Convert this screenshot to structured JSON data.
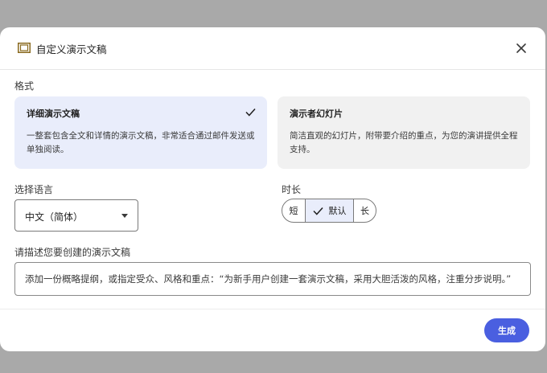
{
  "dialog": {
    "title": "自定义演示文稿",
    "title_icon": "slides-icon",
    "close_icon": "close-icon"
  },
  "format": {
    "label": "格式",
    "options": [
      {
        "title": "详细演示文稿",
        "description": "一整套包含全文和详情的演示文稿，非常适合通过邮件发送或单独阅读。",
        "selected": true
      },
      {
        "title": "演示者幻灯片",
        "description": "简洁直观的幻灯片，附带要介绍的重点，为您的演讲提供全程支持。",
        "selected": false
      }
    ]
  },
  "language": {
    "label": "选择语言",
    "selected": "中文（简体）"
  },
  "duration": {
    "label": "时长",
    "options": [
      "短",
      "默认",
      "长"
    ],
    "selected": "默认"
  },
  "description": {
    "label": "请描述您要创建的演示文稿",
    "placeholder": "添加一份概略提纲，或指定受众、风格和重点：“为新手用户创建一套演示文稿，采用大胆活泼的风格，注重分步说明。”"
  },
  "actions": {
    "generate_label": "生成"
  },
  "colors": {
    "accent": "#4a5fe0",
    "selected_bg": "#e9edfb",
    "unselected_bg": "#f1f1f1",
    "backdrop": "#a9a9a9"
  }
}
